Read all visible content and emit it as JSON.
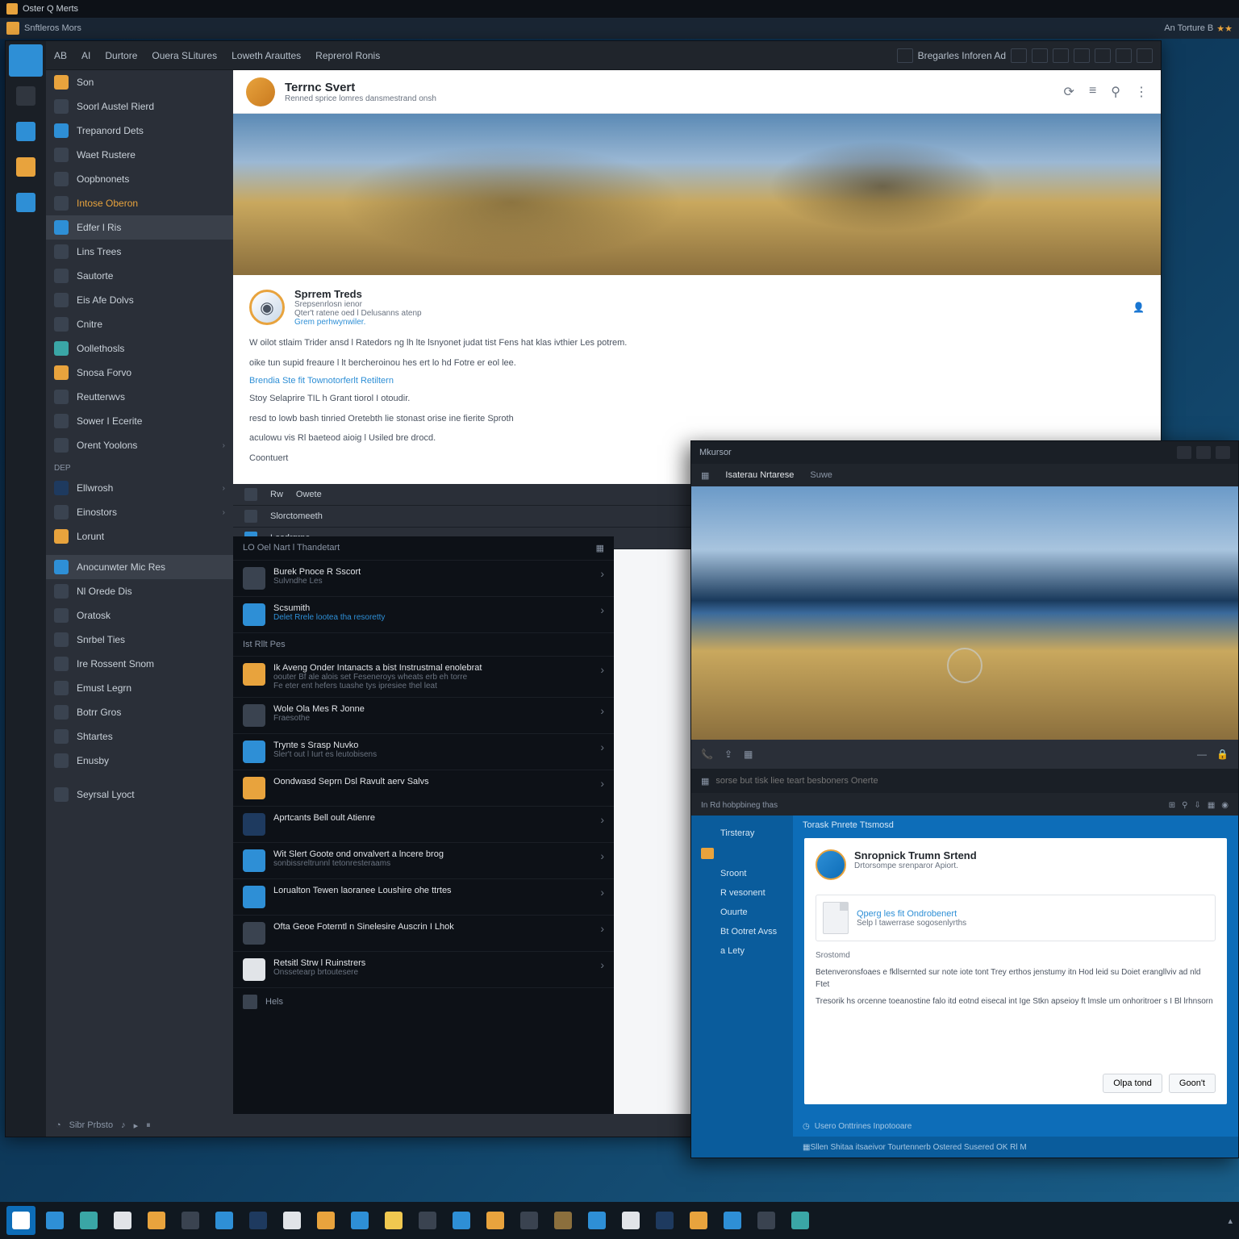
{
  "sys": {
    "title": "Oster Q Merts"
  },
  "apptitle": {
    "label": "Snftleros Mors",
    "right": "An Torture B"
  },
  "menubar": {
    "items": [
      "AB",
      "AI",
      "Durtore",
      "Ouera SLitures",
      "Loweth Arauttes",
      "Reprerol Ronis"
    ],
    "right_label": "Bregarles Inforen Ad"
  },
  "rail": {
    "items": [
      "home",
      "store",
      "files",
      "music",
      "settings"
    ]
  },
  "sidebar": {
    "top": [
      {
        "label": "Son",
        "icon": "sbi-orange"
      },
      {
        "label": "Soorl Austel Rierd",
        "icon": "sbi-gray"
      },
      {
        "label": "Trepanord Dets",
        "icon": "sbi-blue"
      },
      {
        "label": "Waet Rustere",
        "icon": "sbi-gray"
      },
      {
        "label": "Oopbnonets",
        "icon": "sbi-gray"
      },
      {
        "label": "Intose Oberon",
        "icon": "sbi-gray",
        "hl": true
      },
      {
        "label": "Edfer l Ris",
        "icon": "sbi-blue",
        "selected": true
      },
      {
        "label": "Lins Trees",
        "icon": "sbi-gray"
      },
      {
        "label": "Sautorte",
        "icon": "sbi-gray"
      },
      {
        "label": "Eis Afe Dolvs",
        "icon": "sbi-gray"
      },
      {
        "label": "Cnitre",
        "icon": "sbi-gray"
      },
      {
        "label": "Oollethosls",
        "icon": "sbi-teal"
      },
      {
        "label": "Snosa Forvo",
        "icon": "sbi-orange"
      },
      {
        "label": "Reutterwvs",
        "icon": "sbi-gray"
      },
      {
        "label": "Sower I Ecerite",
        "icon": "sbi-gray"
      },
      {
        "label": "Orent Yoolons",
        "icon": "sbi-gray",
        "chev": true
      }
    ],
    "heading1": "Dep",
    "mid": [
      {
        "label": "Ellwrosh",
        "icon": "sbi-navy",
        "chev": true
      },
      {
        "label": "Einostors",
        "icon": "sbi-gray",
        "chev": true
      },
      {
        "label": "Lorunt",
        "icon": "sbi-orange"
      }
    ],
    "group": [
      {
        "label": "Anocunwter Mic Res",
        "icon": "sbi-blue",
        "selected": true
      },
      {
        "label": "Nl Orede Dis",
        "icon": "sbi-gray"
      },
      {
        "label": "Oratosk",
        "icon": "sbi-gray"
      },
      {
        "label": "Snrbel Ties",
        "icon": "sbi-gray"
      },
      {
        "label": "Ire Rossent Snom",
        "icon": "sbi-gray"
      },
      {
        "label": "Emust Legrn",
        "icon": "sbi-gray"
      },
      {
        "label": "Botrr Gros",
        "icon": "sbi-gray"
      },
      {
        "label": "Shtartes",
        "icon": "sbi-gray"
      },
      {
        "label": "Enusby",
        "icon": "sbi-gray"
      }
    ],
    "bottom": [
      {
        "label": "Seyrsal Lyoct",
        "icon": "sbi-gray"
      }
    ]
  },
  "content": {
    "header_title": "Terrnc Svert",
    "header_sub": "Renned sprice lomres dansmestrand onsh",
    "author_name": "Sprrem Treds",
    "author_meta1": "Srepsenrlosn ienor",
    "author_meta2": "Qter't ratene oed l Delusanns atenp",
    "author_link": "Grem perhwynwiler.",
    "para1": "W oilot stlaim Trider ansd l Ratedors ng lh lte lsnyonet judat tist Fens hat klas ivthier Les potrem.",
    "para1b": "oike tun supid freaure l lt bercheroinou hes ert lo hd Fotre er eol lee.",
    "link1": "Brendia Ste fit Townotorferlt Retiltern",
    "para2": "Stoy Selaprire TIL h Grant tiorol I otoudir.",
    "para2b": "resd to lowb bash tinried Oretebth lie stonast orise ine fierite Sproth",
    "para2c": "aculowu vis Rl baeteod aioig l Usiled bre drocd.",
    "para3": "Coontuert"
  },
  "toolbar": {
    "row1": [
      "Rw",
      "Owete"
    ],
    "row2": "Slorctomeeth",
    "row3": "Losdrgrne"
  },
  "feed": {
    "header": "LO Oel Nart l Thandetart",
    "items": [
      {
        "title": "Burek Pnoce R Sscort",
        "sub": "Sulvndhe Les",
        "icon": "fii-gray fii-round"
      },
      {
        "title": "Scsumith",
        "sub": "Delet Rrele lootea tha resoretty",
        "link": true,
        "icon": "fii-blue"
      },
      {
        "title": "Ist Rllt Pes",
        "sub": "",
        "heading": true
      },
      {
        "title": "Ik Aveng Onder Intanacts a bist Instrustmal enolebrat",
        "sub": "oouter Bf ale alois set Feseneroys wheats erb eh torre",
        "sub2": "Fe eter ent hefers tuashe tys ipresiee thel leat",
        "icon": "fii-orange"
      },
      {
        "title": "Wole Ola Mes R Jonne",
        "sub": "Fraesothe",
        "icon": "fii-gray fii-round"
      },
      {
        "title": "Trynte s Srasp Nuvko",
        "sub": "Sler't out l Iurt es leutobisens",
        "icon": "fii-blue"
      },
      {
        "title": "Oondwasd Seprn Dsl Ravult aerv Salvs",
        "sub": "",
        "icon": "fii-orange"
      },
      {
        "title": "Aprtcants Bell oult Atienre",
        "sub": "",
        "icon": "fii-navy"
      },
      {
        "title": "Wit Slert Goote ond onvalvert a lncere brog",
        "sub": "sonbissreltrunnl tetonresteraams",
        "icon": "fii-blue"
      },
      {
        "title": "Lorualton Tewen laoranee Loushire ohe ttrtes",
        "sub": "",
        "icon": "fii-blue"
      },
      {
        "title": "Ofta Geoe Foterntl n Sinelesire Auscrin I Lhok",
        "sub": "",
        "icon": "fii-gray fii-round"
      },
      {
        "title": "Retsitl Strw l Ruinstrers",
        "sub": "Onssetearp brtoutesere",
        "icon": "fii-white"
      }
    ],
    "footer": "Hels"
  },
  "secondary": {
    "title": "Mkursor",
    "tab1": "Isaterau Nrtarese",
    "tab2": "Suwe",
    "input_placeholder": "sorse but tisk liee teart besboners Onerte",
    "path": "In Rd hobpbineg thas"
  },
  "email": {
    "side": [
      "Tirsteray",
      "",
      "Sroont",
      "R vesonent",
      "Ouurte",
      "Bt Ootret Avss",
      "a Lety"
    ],
    "header": "Torask Pnrete Ttsmosd",
    "name": "Snropnick Trumn Srtend",
    "meta": "Drtorsompe srenparor Apiort.",
    "attach_title": "Qperg les fit Ondrobenert",
    "attach_sub": "Selp l tawerrase sogosenlyrths",
    "attach_label": "Srostomd",
    "body1": "Betenveronsfoaes e fkllsernted sur note iote tont Trey erthos jenstumy itn Hod leid su Doiet erangllviv ad nld Ftet",
    "body2": "Tresorik hs orcenne toeanostine falo itd eotnd eisecal int Ige Stkn apseioy ft lmsle um onhoritroer s I Bl lrhnsorn",
    "btn1": "Olpa tond",
    "btn2": "Goon't",
    "footer": "Usero Onttrines Inpotooare",
    "bottom": "Sllen Shitaa itsaeivor Tourtennerb Ostered Susered OK Rl M"
  },
  "statusbar": {
    "label": "Sibr Prbsto"
  },
  "taskbar": {
    "icons": 24
  }
}
